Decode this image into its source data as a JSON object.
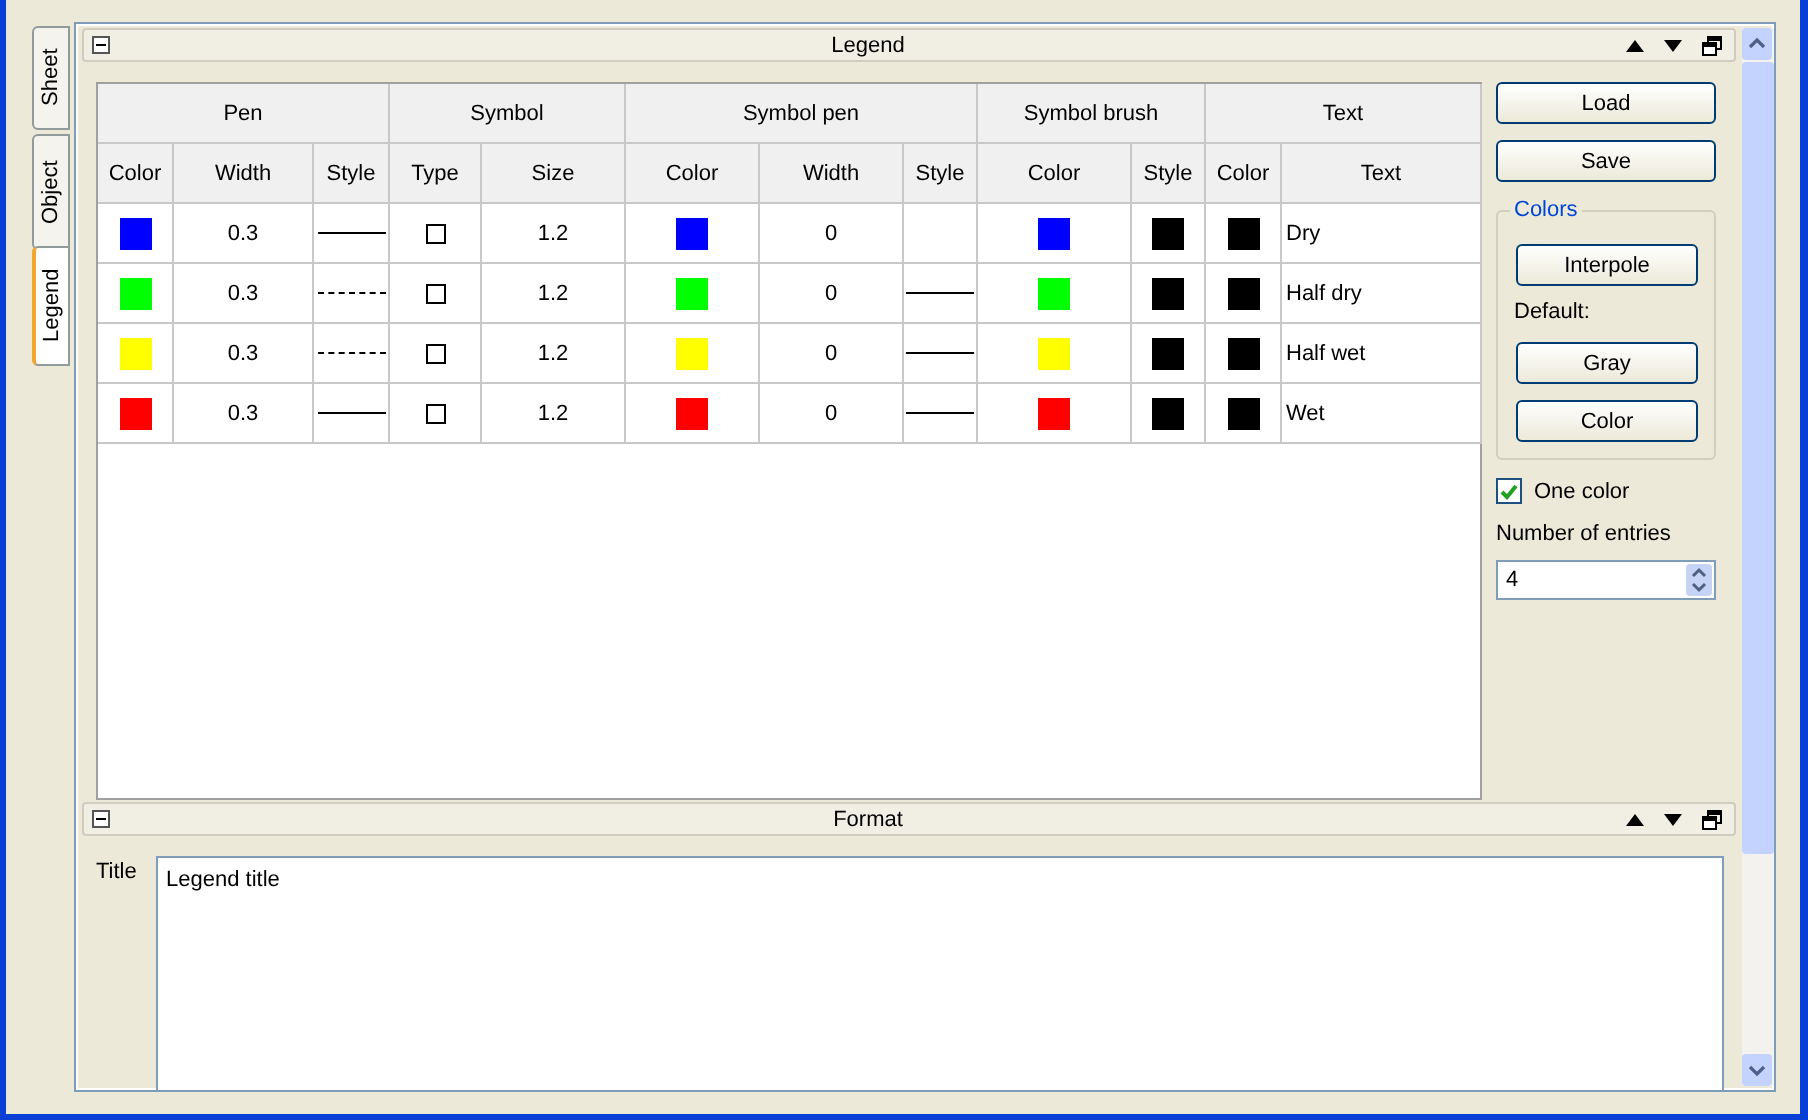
{
  "tabs": [
    {
      "label": "Sheet",
      "selected": false
    },
    {
      "label": "Object",
      "selected": false
    },
    {
      "label": "Legend",
      "selected": true
    }
  ],
  "legend_panel": {
    "title": "Legend",
    "table": {
      "column_groups": [
        {
          "label": "Pen",
          "columns": [
            "Color",
            "Width",
            "Style"
          ]
        },
        {
          "label": "Symbol",
          "columns": [
            "Type",
            "Size"
          ]
        },
        {
          "label": "Symbol pen",
          "columns": [
            "Color",
            "Width",
            "Style"
          ]
        },
        {
          "label": "Symbol brush",
          "columns": [
            "Color",
            "Style"
          ]
        },
        {
          "label": "Text",
          "columns": [
            "Color",
            "Text"
          ]
        }
      ],
      "rows": [
        {
          "cells": [
            {
              "kind": "swatch",
              "color": "#0000ff"
            },
            {
              "kind": "number",
              "text": "0.3"
            },
            {
              "kind": "solid_line"
            },
            {
              "kind": "square_symbol"
            },
            {
              "kind": "number",
              "text": "1.2"
            },
            {
              "kind": "swatch",
              "color": "#0000ff"
            },
            {
              "kind": "number",
              "text": "0"
            },
            {
              "kind": "blank"
            },
            {
              "kind": "swatch",
              "color": "#0000ff"
            },
            {
              "kind": "solid_fill"
            },
            {
              "kind": "swatch",
              "color": "#000000"
            },
            {
              "kind": "text",
              "text": "Dry"
            }
          ]
        },
        {
          "cells": [
            {
              "kind": "swatch",
              "color": "#00ff00"
            },
            {
              "kind": "number",
              "text": "0.3"
            },
            {
              "kind": "dashed_line"
            },
            {
              "kind": "square_symbol"
            },
            {
              "kind": "number",
              "text": "1.2"
            },
            {
              "kind": "swatch",
              "color": "#00ff00"
            },
            {
              "kind": "number",
              "text": "0"
            },
            {
              "kind": "solid_line"
            },
            {
              "kind": "swatch",
              "color": "#00ff00"
            },
            {
              "kind": "solid_fill"
            },
            {
              "kind": "swatch",
              "color": "#000000"
            },
            {
              "kind": "text",
              "text": "Half dry"
            }
          ]
        },
        {
          "cells": [
            {
              "kind": "swatch",
              "color": "#ffff00"
            },
            {
              "kind": "number",
              "text": "0.3"
            },
            {
              "kind": "dashed_line"
            },
            {
              "kind": "square_symbol"
            },
            {
              "kind": "number",
              "text": "1.2"
            },
            {
              "kind": "swatch",
              "color": "#ffff00"
            },
            {
              "kind": "number",
              "text": "0"
            },
            {
              "kind": "solid_line"
            },
            {
              "kind": "swatch",
              "color": "#ffff00"
            },
            {
              "kind": "solid_fill"
            },
            {
              "kind": "swatch",
              "color": "#000000"
            },
            {
              "kind": "text",
              "text": "Half wet"
            }
          ]
        },
        {
          "cells": [
            {
              "kind": "swatch",
              "color": "#ff0000"
            },
            {
              "kind": "number",
              "text": "0.3"
            },
            {
              "kind": "solid_line"
            },
            {
              "kind": "square_symbol"
            },
            {
              "kind": "number",
              "text": "1.2"
            },
            {
              "kind": "swatch",
              "color": "#ff0000"
            },
            {
              "kind": "number",
              "text": "0"
            },
            {
              "kind": "solid_line"
            },
            {
              "kind": "swatch",
              "color": "#ff0000"
            },
            {
              "kind": "solid_fill"
            },
            {
              "kind": "swatch",
              "color": "#000000"
            },
            {
              "kind": "text",
              "text": "Wet"
            }
          ]
        }
      ]
    },
    "buttons": [
      "Load",
      "Save"
    ],
    "colors_group": {
      "title": "Colors",
      "interpolate_button": "Interpole",
      "default_label": "Default:",
      "default_buttons": [
        "Gray",
        "Color"
      ]
    },
    "one_color": {
      "label": "One color",
      "checked": true
    },
    "entries": {
      "label": "Number of entries",
      "value": "4"
    }
  },
  "format_panel": {
    "title": "Format",
    "title_label": "Title",
    "title_value": "Legend title"
  }
}
